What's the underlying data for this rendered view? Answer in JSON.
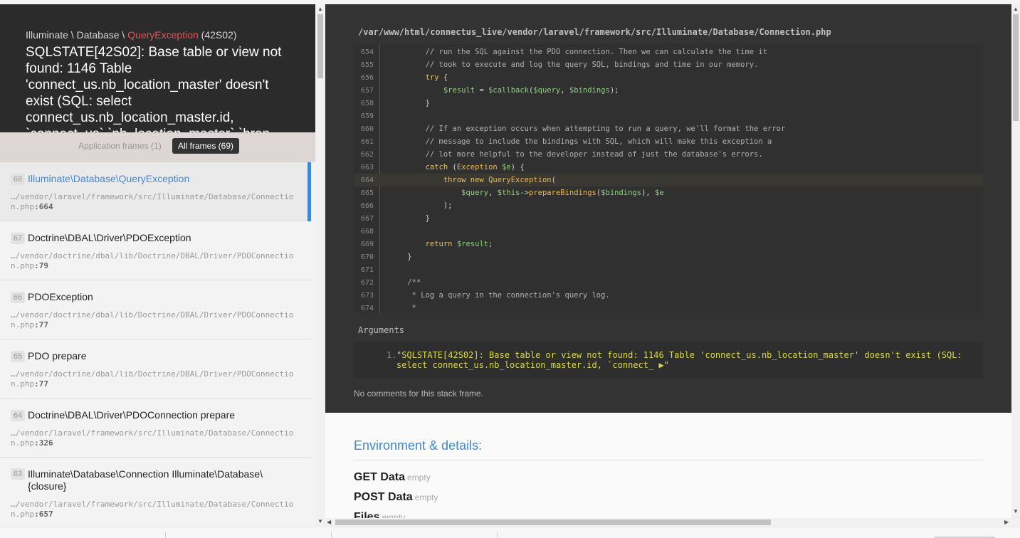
{
  "exception": {
    "namespace": "Illuminate \\ Database \\ ",
    "class_name": "QueryException",
    "code": " (42S02)",
    "message": "SQLSTATE[42S02]: Base table or view not found: 1146 Table 'connect_us.nb_location_master' doesn't exist (SQL: select connect_us.nb_location_master.id, `connect_us`.`nb_location_master`.`bran"
  },
  "tabs": {
    "application": "Application frames (1)",
    "all": "All frames (69)"
  },
  "frames": [
    {
      "index": "68",
      "title": "Illuminate\\Database\\QueryException",
      "path": "…/vendor/laravel/framework/src/Illuminate/Database/Connection.php",
      "line": ":664"
    },
    {
      "index": "67",
      "title": "Doctrine\\DBAL\\Driver\\PDOException",
      "path": "…/vendor/doctrine/dbal/lib/Doctrine/DBAL/Driver/PDOConnection.php",
      "line": ":79"
    },
    {
      "index": "66",
      "title": "PDOException",
      "path": "…/vendor/doctrine/dbal/lib/Doctrine/DBAL/Driver/PDOConnection.php",
      "line": ":77"
    },
    {
      "index": "65",
      "title": "PDO prepare",
      "path": "…/vendor/doctrine/dbal/lib/Doctrine/DBAL/Driver/PDOConnection.php",
      "line": ":77"
    },
    {
      "index": "64",
      "title": "Doctrine\\DBAL\\Driver\\PDOConnection prepare",
      "path": "…/vendor/laravel/framework/src/Illuminate/Database/Connection.php",
      "line": ":326"
    },
    {
      "index": "63",
      "title": "Illuminate\\Database\\Connection Illuminate\\Database\\{closure}",
      "path": "…/vendor/laravel/framework/src/Illuminate/Database/Connection.php",
      "line": ":657"
    }
  ],
  "code": {
    "file_path": "/var/www/html/connectus_live/vendor/laravel/framework/src/Illuminate/Database/Connection.php",
    "active_line": "664"
  },
  "arguments": {
    "label": "Arguments",
    "number": "1.",
    "value": "\"SQLSTATE[42S02]: Base table or view not found: 1146 Table 'connect_us.nb_location_master' doesn't exist (SQL: select connect_us.nb_location_master.id, `connect_ ▶\""
  },
  "comments": "No comments for this stack frame.",
  "environment": {
    "title": "Environment & details:",
    "rows": [
      {
        "label": "GET Data",
        "status": "empty"
      },
      {
        "label": "POST Data",
        "status": "empty"
      },
      {
        "label": "Files",
        "status": "empty"
      }
    ]
  },
  "colors": {
    "accent": "#4288ce",
    "exception_class": "#e95353",
    "code_bg": "#333333"
  }
}
